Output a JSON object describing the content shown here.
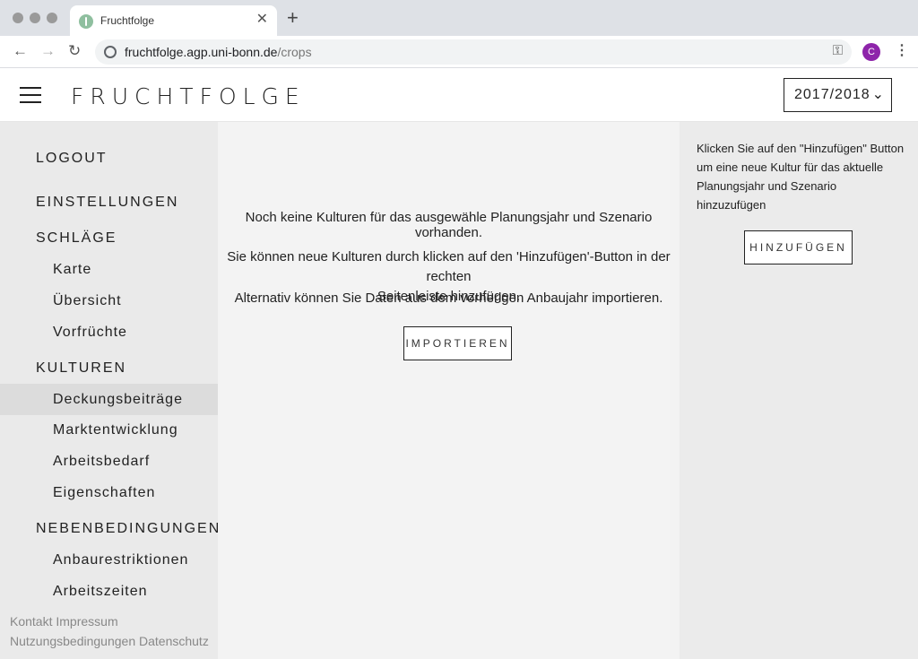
{
  "browser": {
    "tab_title": "Fruchtfolge",
    "tab_close": "✕",
    "new_tab": "+",
    "url_host": "fruchtfolge.agp.uni-bonn.de",
    "url_path": "/crops",
    "profile_initial": "C"
  },
  "header": {
    "brand": "FRUCHTFOLGE",
    "year_select": "2017/2018"
  },
  "sidebar": {
    "logout": "LOGOUT",
    "einstellungen": "EINSTELLUNGEN",
    "schlaege": "SCHLÄGE",
    "schlaege_items": [
      "Karte",
      "Übersicht",
      "Vorfrüchte"
    ],
    "kulturen": "KULTUREN",
    "kulturen_items": [
      "Deckungsbeiträge",
      "Marktentwicklung",
      "Arbeitsbedarf",
      "Eigenschaften"
    ],
    "nebenbedingungen": "NEBENBEDINGUNGEN",
    "nebenbedingungen_items": [
      "Anbaurestriktionen",
      "Arbeitszeiten"
    ],
    "footer_line1": "Kontakt Impressum",
    "footer_line2": "Nutzungsbedingungen Datenschutz"
  },
  "main": {
    "empty_message": "Noch keine Kulturen für das ausgewähle Planungsjahr und Szenario vorhanden.",
    "hint_line1": "Sie können neue Kulturen durch klicken auf den 'Hinzufügen'-Button in der rechten",
    "hint_line2": "Seitenleiste hinzufügen.",
    "alt_message": "Alternativ können Sie Daten aus dem vorherigen Anbaujahr importieren.",
    "import_button": "IMPORTIEREN"
  },
  "right": {
    "hint": "Klicken Sie auf den \"Hinzufügen\" Button um eine neue Kultur für das aktuelle Planungsjahr und Szenario hinzuzufügen",
    "add_button": "HINZUFÜGEN"
  }
}
